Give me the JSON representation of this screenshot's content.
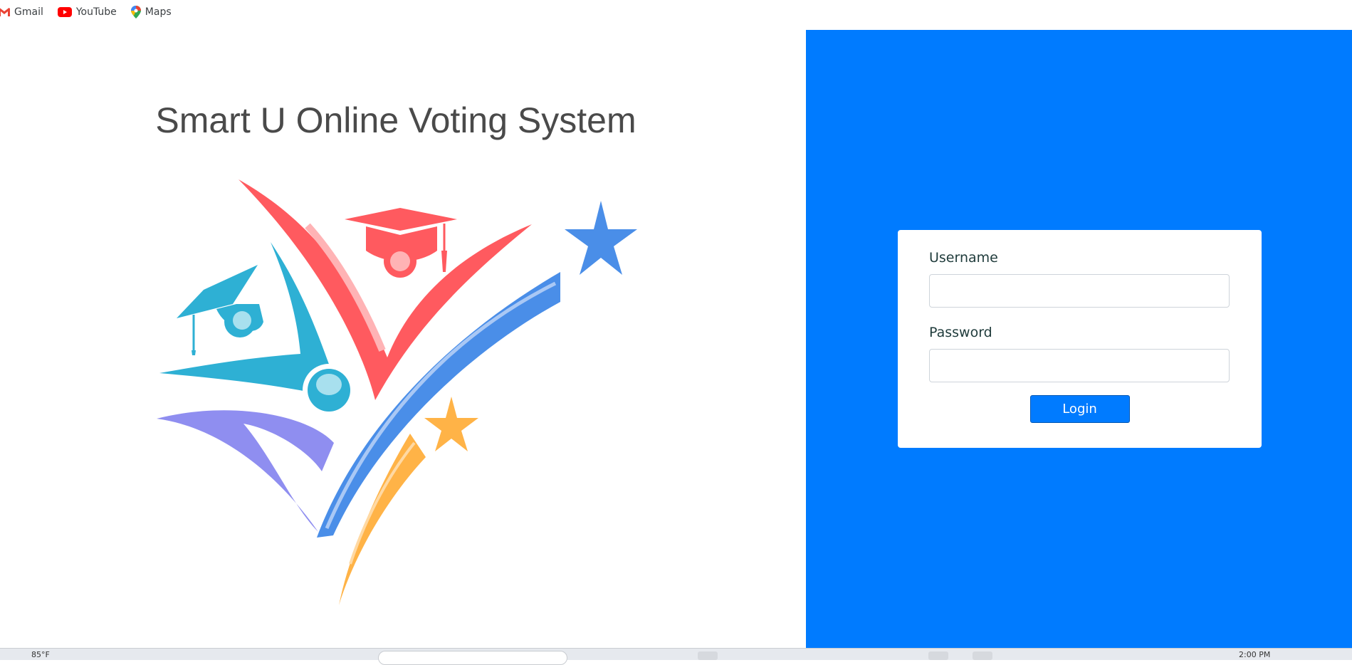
{
  "bookmarks": [
    {
      "label": "Gmail",
      "icon": "gmail-icon"
    },
    {
      "label": "YouTube",
      "icon": "youtube-icon"
    },
    {
      "label": "Maps",
      "icon": "maps-pin-icon"
    }
  ],
  "page": {
    "title": "Smart U Online Voting System",
    "logo_icon": "voting-system-logo"
  },
  "login_form": {
    "username_label": "Username",
    "username_value": "",
    "password_label": "Password",
    "password_value": "",
    "login_button_label": "Login"
  },
  "taskbar": {
    "temperature": "85°F",
    "time": "2:00 PM"
  },
  "colors": {
    "accent": "#007bff",
    "logo_red": "#ff5a5f",
    "logo_teal": "#2eb0d4",
    "logo_blue": "#4a8ee8",
    "logo_purple": "#8f8ef0",
    "logo_orange": "#ffb347"
  }
}
